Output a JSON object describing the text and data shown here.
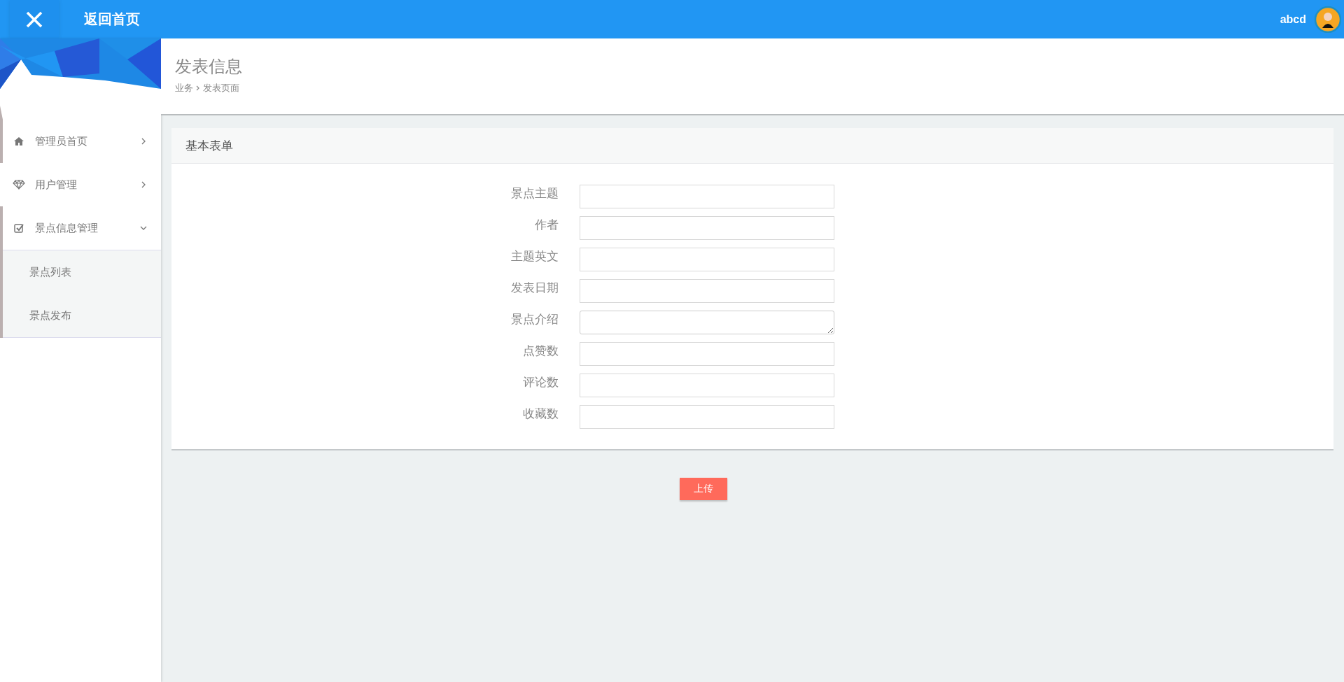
{
  "header": {
    "title": "返回首页",
    "username": "abcd"
  },
  "sidebar": {
    "items": [
      {
        "label": "管理员首页",
        "selected": true,
        "expanded": false
      },
      {
        "label": "用户管理",
        "selected": false,
        "expanded": false
      },
      {
        "label": "景点信息管理",
        "selected": true,
        "expanded": true,
        "children": [
          {
            "label": "景点列表"
          },
          {
            "label": "景点发布"
          }
        ]
      }
    ]
  },
  "page": {
    "title": "发表信息",
    "breadcrumb": [
      "业务",
      "发表页面"
    ]
  },
  "form": {
    "title": "基本表单",
    "fields": [
      {
        "label": "景点主题",
        "kind": "input"
      },
      {
        "label": "作者",
        "kind": "input"
      },
      {
        "label": "主题英文",
        "kind": "input"
      },
      {
        "label": "发表日期",
        "kind": "input"
      },
      {
        "label": "景点介绍",
        "kind": "textarea"
      },
      {
        "label": "点赞数",
        "kind": "input"
      },
      {
        "label": "评论数",
        "kind": "input"
      },
      {
        "label": "收藏数",
        "kind": "input"
      }
    ],
    "submit": "上传"
  }
}
